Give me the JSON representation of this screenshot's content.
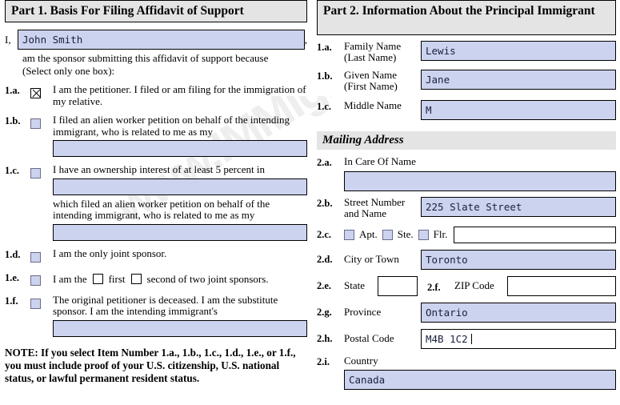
{
  "watermark": {
    "text": "www.IMMIgrationPro.com"
  },
  "part1": {
    "header": "Part 1.  Basis For Filing Affidavit of Support",
    "i_letter": "I,",
    "sponsor_name_value": "John Smith",
    "comma": ",",
    "intro_line1": "am the sponsor submitting this affidavit of support because",
    "intro_line2": "(Select only one box):",
    "options": [
      {
        "num": "1.a.",
        "checked": true,
        "text": "I am the petitioner.  I filed or am filing for the immigration of my relative.",
        "field_value": ""
      },
      {
        "num": "1.b.",
        "checked": false,
        "text": "I filed an alien worker petition on behalf of the intending immigrant, who is related to me as my",
        "field_value": ""
      },
      {
        "num": "1.c.",
        "checked": false,
        "text": "I have an ownership interest of at least 5 percent in",
        "field_value": "",
        "text2": "which filed an alien worker petition on behalf of the intending immigrant, who is related to me as my",
        "field2_value": ""
      },
      {
        "num": "1.d.",
        "checked": false,
        "text": "I am the only joint sponsor."
      },
      {
        "num": "1.e.",
        "checked": false,
        "text_a": "I am the",
        "text_b": "first",
        "text_c": "second of two joint sponsors."
      },
      {
        "num": "1.f.",
        "checked": false,
        "text": "The original petitioner is deceased.  I am the substitute sponsor.  I am the intending immigrant's",
        "field_value": ""
      }
    ],
    "note": "NOTE:  If you select Item Number 1.a., 1.b., 1.c., 1.d., 1.e., or 1.f., you must include proof of your U.S. citizenship, U.S. national status, or lawful permanent resident status."
  },
  "part2": {
    "header": "Part 2.  Information About the Principal Immigrant",
    "fields": [
      {
        "num": "1.a.",
        "label_line1": "Family Name",
        "label_line2": "(Last Name)",
        "value": "Lewis"
      },
      {
        "num": "1.b.",
        "label_line1": "Given Name",
        "label_line2": "(First Name)",
        "value": "Jane"
      },
      {
        "num": "1.c.",
        "label_line1": "Middle Name",
        "label_line2": "",
        "value": "M"
      }
    ],
    "mailing_header": "Mailing Address",
    "in_care_of": {
      "num": "2.a.",
      "label": "In Care Of Name",
      "value": ""
    },
    "street": {
      "num": "2.b.",
      "label_line1": "Street Number",
      "label_line2": "and Name",
      "value": "225 Slate Street"
    },
    "unit": {
      "num": "2.c.",
      "apt_label": "Apt.",
      "ste_label": "Ste.",
      "flr_label": "Flr.",
      "apt_checked": false,
      "ste_checked": false,
      "flr_checked": false,
      "value": ""
    },
    "city": {
      "num": "2.d.",
      "label": "City or Town",
      "value": "Toronto"
    },
    "state": {
      "num": "2.e.",
      "label": "State",
      "value": ""
    },
    "zip": {
      "num": "2.f.",
      "label": "ZIP Code",
      "value": ""
    },
    "province": {
      "num": "2.g.",
      "label": "Province",
      "value": "Ontario"
    },
    "postal": {
      "num": "2.h.",
      "label": "Postal Code",
      "value": "M4B 1C2",
      "focused": true
    },
    "country": {
      "num": "2.i.",
      "label": "Country",
      "value": "Canada"
    }
  },
  "colors": {
    "field_fill": "#ccd3ee",
    "header_bar": "#e4e4e4",
    "border": "#000000",
    "text": "#000000"
  }
}
